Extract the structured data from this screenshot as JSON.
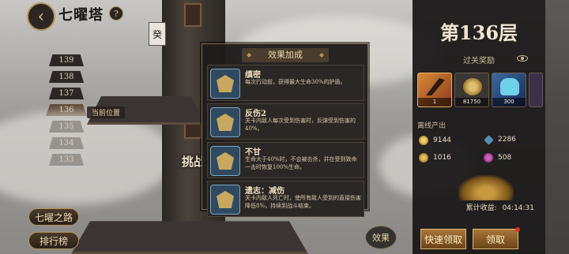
{
  "header": {
    "title": "七曜塔",
    "back_label": "‹",
    "help_label": "?"
  },
  "tower": {
    "sign_glyph": "癸",
    "challenge_label": "挑战"
  },
  "floor_list": {
    "floors": [
      "139",
      "138",
      "137",
      "136",
      "135",
      "134",
      "133"
    ],
    "current_floor": "136",
    "current_label": "当前位置"
  },
  "left_buttons": {
    "seven_road": "七曜之路",
    "leaderboard": "排行榜"
  },
  "effect_button": "效果",
  "popup": {
    "title": "效果加成",
    "effects": [
      {
        "name": "缜密",
        "desc": "每次行动前，获得最大生命30%的护盾。"
      },
      {
        "name": "反伤2",
        "desc": "关卡内敌人每次受到伤害时，反弹受到伤害的40%。"
      },
      {
        "name": "不甘",
        "desc": "生命大于40%时，不会被击杀，并在受到致命一击时恢复100%生命。"
      },
      {
        "name": "遗志：减伤",
        "desc": "关卡内敌人死亡时，使所有敌人受到的直接伤害降低8%，持续到战斗结束。"
      }
    ]
  },
  "right_panel": {
    "floor_title": "第136层",
    "reward_title": "过关奖励",
    "rewards": [
      {
        "qty": "1",
        "icon": "blade-fragment-icon"
      },
      {
        "qty": "81750",
        "icon": "gold-coin-icon"
      },
      {
        "qty": "300",
        "icon": "spirit-crystal-icon"
      },
      {
        "qty": "",
        "icon": "partial-item-icon"
      }
    ],
    "offline_title": "离线产出",
    "offline": [
      {
        "value": "9144",
        "icon": "gold-icon"
      },
      {
        "value": "2286",
        "icon": "gem-icon"
      },
      {
        "value": "1016",
        "icon": "coin-icon"
      },
      {
        "value": "508",
        "icon": "orb-icon"
      }
    ],
    "accumulated_label": "累计收益:",
    "accumulated_time": "04:14:31",
    "quick_claim": "快速领取",
    "claim": "领取"
  }
}
